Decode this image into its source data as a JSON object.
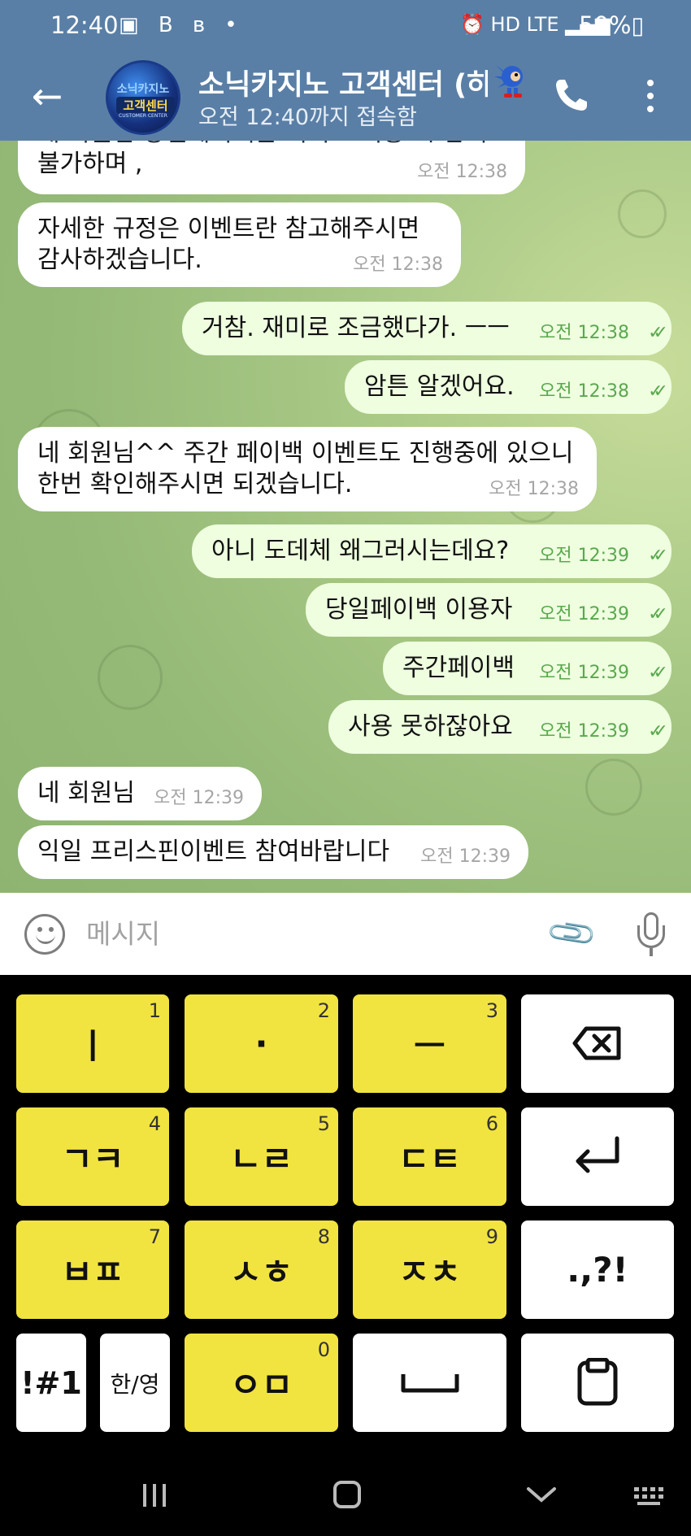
{
  "status_bar": {
    "time": "12:40",
    "left_icons": "▣ B ʙ •",
    "right_icons": "⏰ HD LTE ▂▄▆",
    "battery": "50%▯"
  },
  "header": {
    "back_icon": "←",
    "title": "소닉카지노 고객센터 (하",
    "subtitle": "오전 12:40까지 접속함",
    "avatar_text_top": "소닉카지노",
    "avatar_text_main": "고객센터",
    "avatar_text_small": "CUSTOMER CENTER",
    "call_icon": "phone-icon",
    "menu_icon": "more-vert-icon"
  },
  "messages": [
    {
      "dir": "in",
      "text_1": "네 회원님 당일페이백은 기지노 이용 시 참여",
      "text_2": "불가하며 ,",
      "time": "오전 12:38"
    },
    {
      "dir": "in",
      "text_1": "자세한 규정은 이벤트란 참고해주시면",
      "text_2": "감사하겠습니다.",
      "time": "오전 12:38"
    },
    {
      "dir": "out",
      "text": "거참. 재미로 조금했다가. ㅡㅡ",
      "time": "오전 12:38",
      "check": "✓✓"
    },
    {
      "dir": "out",
      "text": "암튼 알겠어요.",
      "time": "오전 12:38",
      "check": "✓✓"
    },
    {
      "dir": "in",
      "text_1": "네 회원님^^ 주간 페이백 이벤트도 진행중에 있으니",
      "text_2": "한번 확인해주시면 되겠습니다.",
      "time": "오전 12:38"
    },
    {
      "dir": "out",
      "text": "아니 도데체 왜그러시는데요?",
      "time": "오전 12:39",
      "check": "✓✓"
    },
    {
      "dir": "out",
      "text": "당일페이백 이용자",
      "time": "오전 12:39",
      "check": "✓✓"
    },
    {
      "dir": "out",
      "text": "주간페이백",
      "time": "오전 12:39",
      "check": "✓✓"
    },
    {
      "dir": "out",
      "text": "사용 못하잖아요",
      "time": "오전 12:39",
      "check": "✓✓"
    },
    {
      "dir": "in",
      "text": "네 회원님",
      "time": "오전 12:39"
    },
    {
      "dir": "in",
      "text": "익일 프리스핀이벤트 참여바랍니다",
      "time": "오전 12:39"
    }
  ],
  "composer": {
    "placeholder": "메시지",
    "emoji_icon": "emoji-icon",
    "attach_icon": "📎",
    "mic_icon": "mic-icon"
  },
  "keyboard": {
    "keys": [
      {
        "label": "ㅣ",
        "num": "1"
      },
      {
        "label": "·",
        "num": "2"
      },
      {
        "label": "ㅡ",
        "num": "3"
      },
      {
        "label": "⌫",
        "num": ""
      },
      {
        "label": "ㄱㅋ",
        "num": "4"
      },
      {
        "label": "ㄴㄹ",
        "num": "5"
      },
      {
        "label": "ㄷㅌ",
        "num": "6"
      },
      {
        "label": "↵",
        "num": ""
      },
      {
        "label": "ㅂㅍ",
        "num": "7"
      },
      {
        "label": "ㅅㅎ",
        "num": "8"
      },
      {
        "label": "ㅈㅊ",
        "num": "9"
      },
      {
        "label": ".,?!",
        "num": ""
      },
      {
        "label": "!#1",
        "num": ""
      },
      {
        "label": "한/영",
        "num": ""
      },
      {
        "label": "ㅇㅁ",
        "num": "0"
      },
      {
        "label": "␣",
        "num": ""
      },
      {
        "label": "clipboard",
        "num": ""
      }
    ]
  },
  "navbar": {
    "recents": "|||",
    "home": "◯",
    "back": "⌄",
    "keyboard": "⌨"
  },
  "colors": {
    "header": "#5a7fa6",
    "out_bubble": "#eefedf",
    "in_bubble": "#ffffff",
    "key_yellow": "#f2e440",
    "check_green": "#5aa84e"
  }
}
